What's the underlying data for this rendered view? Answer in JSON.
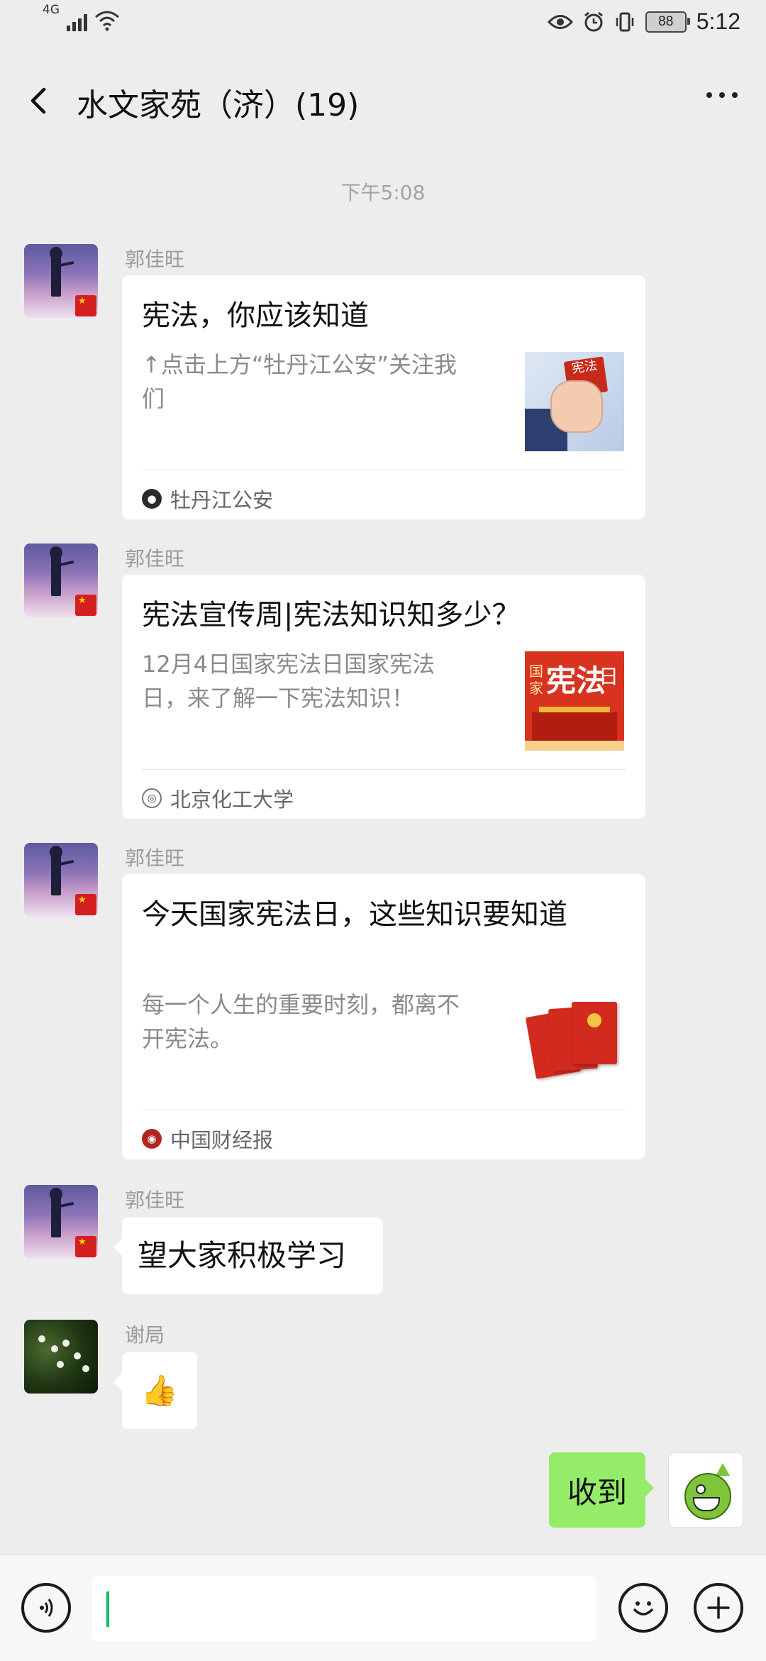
{
  "status_bar": {
    "network": "4G",
    "battery": "88",
    "time": "5:12"
  },
  "header": {
    "title": "水文家苑（济）(19)"
  },
  "timestamp": "下午5:08",
  "messages": [
    {
      "sender": "郭佳旺",
      "type": "article",
      "title": "宪法，你应该知道",
      "description": "↑点击上方“牡丹江公安”关注我们",
      "source": "牡丹江公安",
      "thumb_text": "宪法"
    },
    {
      "sender": "郭佳旺",
      "type": "article",
      "title": "宪法宣传周|宪法知识知多少？",
      "description": "12月4日国家宪法日国家宪法日，来了解一下宪法知识！",
      "source": "北京化工大学",
      "thumb_text_a": "国家",
      "thumb_text_b": "宪法",
      "thumb_text_c": "日"
    },
    {
      "sender": "郭佳旺",
      "type": "article",
      "title": "今天国家宪法日，这些知识要知道",
      "description": "每一个人生的重要时刻，都离不开宪法。",
      "source": "中国财经报"
    },
    {
      "sender": "郭佳旺",
      "type": "text",
      "text": "望大家积极学习"
    },
    {
      "sender": "谢局",
      "type": "emoji",
      "text": "👍"
    }
  ],
  "sent_message": {
    "text": "收到"
  },
  "icons": {
    "back": "chevron-left-icon",
    "more": "more-dots-icon",
    "voice": "voice-icon",
    "emoji": "emoji-icon",
    "plus": "plus-icon"
  },
  "colors": {
    "background": "#ededed",
    "sent_bubble": "#95ec69",
    "cursor": "#07c160"
  }
}
